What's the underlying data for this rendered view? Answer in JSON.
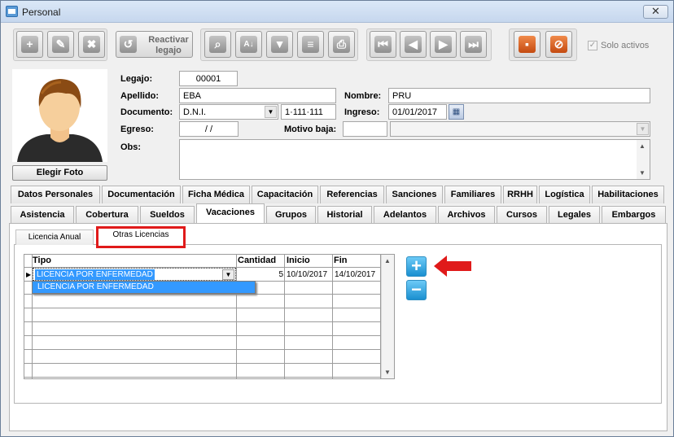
{
  "window": {
    "title": "Personal",
    "close": "✕"
  },
  "toolbar": {
    "reactivar_label_1": "Reactivar",
    "reactivar_label_2": "legajo",
    "solo_activos_label": "Solo activos",
    "solo_activos_checked": true
  },
  "form": {
    "legajo_label": "Legajo:",
    "legajo_value": "00001",
    "apellido_label": "Apellido:",
    "apellido_value": "EBA",
    "nombre_label": "Nombre:",
    "nombre_value": "PRU",
    "documento_label": "Documento:",
    "doc_tipo": "D.N.I.",
    "doc_numero": "1·111·111",
    "ingreso_label": "Ingreso:",
    "ingreso_value": "01/01/2017",
    "egreso_label": "Egreso:",
    "egreso_value": "/ /",
    "motivo_label": "Motivo baja:",
    "motivo_value": "",
    "obs_label": "Obs:",
    "obs_value": "",
    "elegir_foto": "Elegir Foto"
  },
  "tabs_row1": [
    "Datos Personales",
    "Documentación",
    "Ficha Médica",
    "Capacitación",
    "Referencias",
    "Sanciones",
    "Familiares",
    "RRHH",
    "Logística",
    "Habilitaciones"
  ],
  "tabs_row2": [
    "Asistencia",
    "Cobertura",
    "Sueldos",
    "Vacaciones",
    "Grupos",
    "Historial",
    "Adelantos",
    "Archivos",
    "Cursos",
    "Legales",
    "Embargos"
  ],
  "subtabs": [
    "Licencia Anual",
    "Otras Licencias"
  ],
  "grid": {
    "headers": [
      "Tipo",
      "Cantidad",
      "Inicio",
      "Fin"
    ],
    "row": {
      "tipo": "LICENCIA POR ENFERMEDAD",
      "cantidad": "5",
      "inicio": "10/10/2017",
      "fin": "14/10/2017"
    },
    "dropdown_option": "LICENCIA POR ENFERMEDAD"
  },
  "colors": {
    "accent_red": "#e01a1a",
    "selection_blue": "#3399ff"
  }
}
